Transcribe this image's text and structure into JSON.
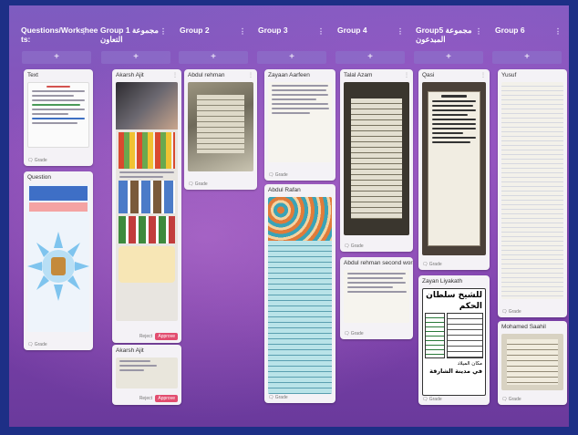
{
  "columns": [
    {
      "title": "Questions/Workshee ts:",
      "add": "+"
    },
    {
      "title": "Group 1 مجموعة التعاون",
      "add": "+"
    },
    {
      "title": "Group 2",
      "add": "+"
    },
    {
      "title": "Group 3",
      "add": "+"
    },
    {
      "title": "Group 4",
      "add": "+"
    },
    {
      "title": "Group5 مجموعة المبدعون",
      "add": "+"
    },
    {
      "title": "Group 6",
      "add": "+"
    }
  ],
  "cards": {
    "c0_text": {
      "title": "Text",
      "foot": "Grade"
    },
    "c0_question": {
      "title": "Question",
      "foot": "Grade"
    },
    "c1_akarsh": {
      "title": "Akarsh Ajit",
      "reject": "Reject",
      "approve": "Approve"
    },
    "c1_akarsh2": {
      "title": "Akarsh Ajit",
      "reject": "Reject",
      "approve": "Approve"
    },
    "c2_abdul": {
      "title": "Abdul rehman",
      "foot": "Grade"
    },
    "c3_zayaan": {
      "title": "Zayaan Aarfeen",
      "foot": "Grade"
    },
    "c3_rafan": {
      "title": "Abdul Rafan",
      "foot": "Grade"
    },
    "c4_talal": {
      "title": "Talal Azam",
      "foot": "Grade"
    },
    "c4_second": {
      "title": "Abdul rehman second work",
      "foot": "Grade"
    },
    "c5_qasi": {
      "title": "Qasi",
      "foot": "Grade"
    },
    "c5_zayan": {
      "title": "Zayan Liyakath",
      "foot": "Grade",
      "ar1": "للشيخ سلطان",
      "ar2": "الحكم",
      "ar3": "مكان الميلاد",
      "ar4": "في مدينة الشارقة"
    },
    "c6_yusuf": {
      "title": "Yusuf",
      "foot": "Grade"
    },
    "c6_saahil": {
      "title": "Mohamed Saahil",
      "foot": "Grade"
    }
  }
}
